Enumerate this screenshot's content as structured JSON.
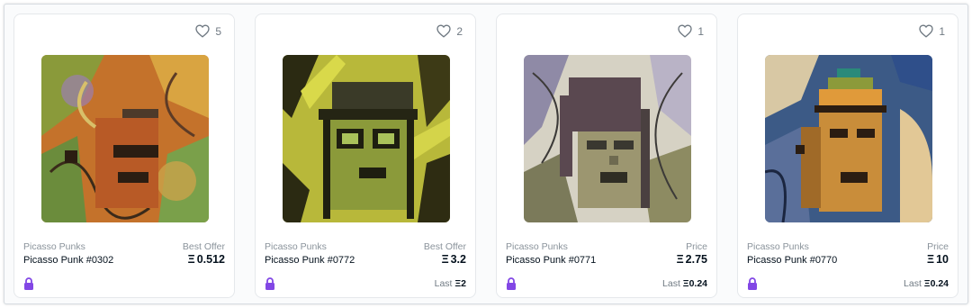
{
  "accent_color": "#8247e5",
  "cards": [
    {
      "likes": "5",
      "collection": "Picasso Punks",
      "name": "Picasso Punk #0302",
      "price_label": "Best Offer",
      "price": "0.512",
      "currency_symbol": "Ξ",
      "last_label": "",
      "last_price": "",
      "art_icon": "picasso-punk-artwork"
    },
    {
      "likes": "2",
      "collection": "Picasso Punks",
      "name": "Picasso Punk #0772",
      "price_label": "Best Offer",
      "price": "3.2",
      "currency_symbol": "Ξ",
      "last_label": "Last",
      "last_price": "2",
      "art_icon": "picasso-punk-artwork"
    },
    {
      "likes": "1",
      "collection": "Picasso Punks",
      "name": "Picasso Punk #0771",
      "price_label": "Price",
      "price": "2.75",
      "currency_symbol": "Ξ",
      "last_label": "Last",
      "last_price": "0.24",
      "art_icon": "picasso-punk-artwork"
    },
    {
      "likes": "1",
      "collection": "Picasso Punks",
      "name": "Picasso Punk #0770",
      "price_label": "Price",
      "price": "10",
      "currency_symbol": "Ξ",
      "last_label": "Last",
      "last_price": "0.24",
      "art_icon": "picasso-punk-artwork"
    }
  ]
}
